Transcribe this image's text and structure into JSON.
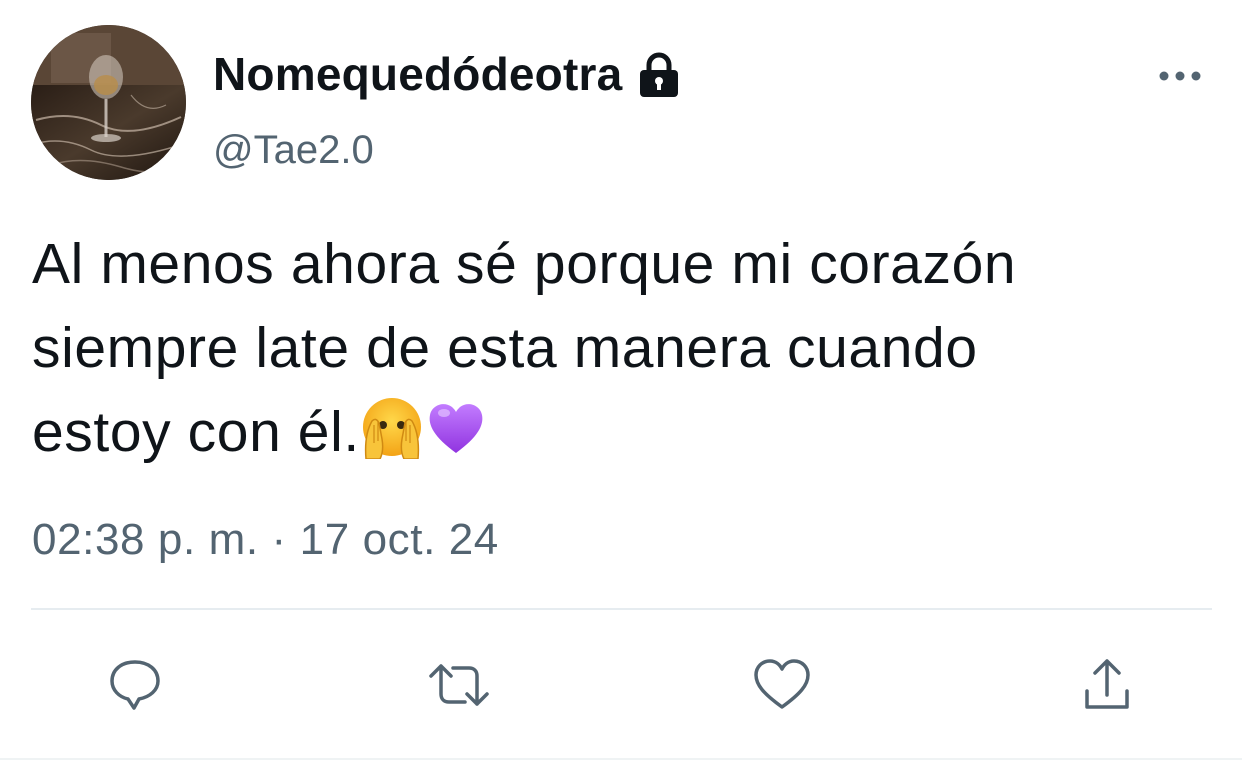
{
  "author": {
    "display_name": "Nomequedódeotra",
    "handle": "@Tae2.0",
    "protected_icon": "lock-icon",
    "avatar": "avatar-wine-glass-photo"
  },
  "tweet": {
    "lines": [
      "Al menos ahora sé porque mi corazón",
      "siempre late de esta manera cuando",
      "estoy con él."
    ],
    "emojis": [
      "face-with-hands-over-eyes-emoji",
      "purple-heart-emoji"
    ],
    "timestamp": "02:38 p. m. · 17 oct. 24"
  },
  "actions": [
    {
      "name": "reply",
      "icon": "reply-icon"
    },
    {
      "name": "retweet",
      "icon": "retweet-icon"
    },
    {
      "name": "like",
      "icon": "heart-icon"
    },
    {
      "name": "share",
      "icon": "share-icon"
    }
  ],
  "colors": {
    "text_primary": "#0f1419",
    "text_secondary": "#536471",
    "divider": "#e6ecf0",
    "purple_heart": "#a64ff0"
  }
}
